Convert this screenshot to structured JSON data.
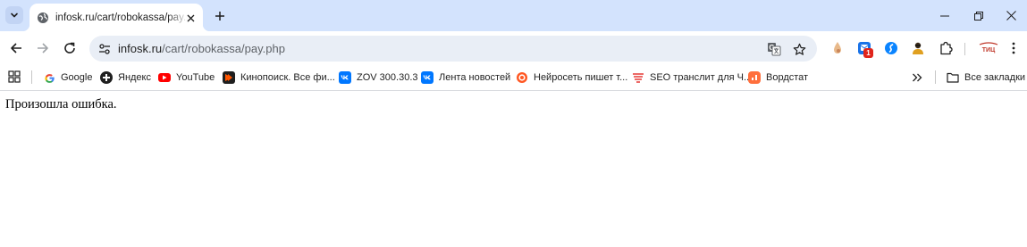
{
  "tab": {
    "title": "infosk.ru/cart/robokassa/pay.php",
    "new_tab_symbol": "+"
  },
  "omnibox": {
    "host": "infosk.ru",
    "path": "/cart/robokassa/pay.php"
  },
  "extensions": {
    "badge_count": "1",
    "red_ext_label": "ТИЦ"
  },
  "bookmarks": {
    "items": [
      {
        "label": "Google",
        "icon": "google-icon"
      },
      {
        "label": "Яндекс",
        "icon": "yandex-icon"
      },
      {
        "label": "YouTube",
        "icon": "youtube-icon"
      },
      {
        "label": "Кинопоиск. Все фи...",
        "icon": "kinopoisk-icon"
      },
      {
        "label": "ZOV 300.30.3",
        "icon": "vk-icon"
      },
      {
        "label": "Лента новостей",
        "icon": "vk-icon"
      },
      {
        "label": "Нейросеть пишет т...",
        "icon": "neuro-icon"
      },
      {
        "label": "SEO транслит для Ч...",
        "icon": "seo-icon"
      },
      {
        "label": "Вордстат",
        "icon": "wordstat-icon"
      }
    ],
    "all_bookmarks_label": "Все закладки"
  },
  "page": {
    "message": "Произошла ошибка."
  },
  "colors": {
    "tabstrip": "#d3e3fd",
    "omnibox": "#e9eef6",
    "vk": "#0077ff",
    "youtube": "#ff0000",
    "kinopoisk": "#ff5500"
  }
}
